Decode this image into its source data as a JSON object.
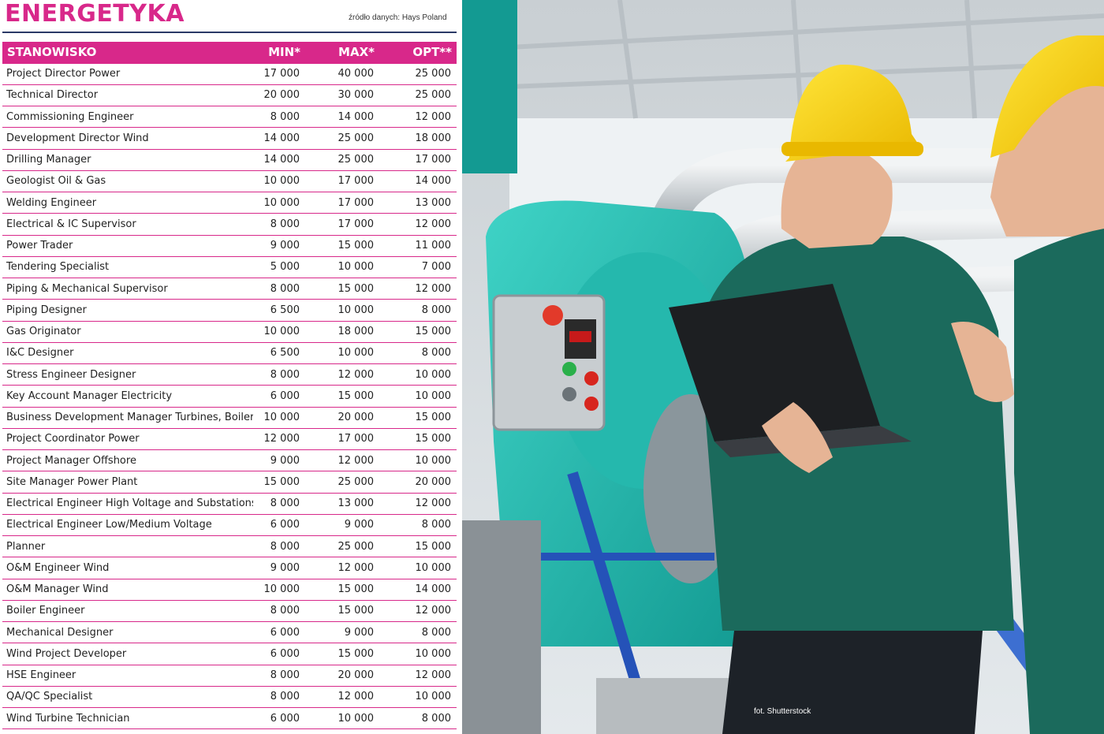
{
  "header": {
    "title": "ENERGETYKA",
    "source": "źródło danych: Hays Poland"
  },
  "table": {
    "columns": [
      "STANOWISKO",
      "MIN*",
      "MAX*",
      "OPT**"
    ],
    "rows": [
      [
        "Project Director Power",
        "17 000",
        "40 000",
        "25 000"
      ],
      [
        "Technical Director",
        "20 000",
        "30 000",
        "25 000"
      ],
      [
        "Commissioning Engineer",
        "8 000",
        "14 000",
        "12 000"
      ],
      [
        "Development Director Wind",
        "14 000",
        "25 000",
        "18 000"
      ],
      [
        "Drilling Manager",
        "14 000",
        "25 000",
        "17 000"
      ],
      [
        "Geologist Oil & Gas",
        "10 000",
        "17 000",
        "14 000"
      ],
      [
        "Welding Engineer",
        "10 000",
        "17 000",
        "13 000"
      ],
      [
        "Electrical & IC Supervisor",
        "8 000",
        "17 000",
        "12 000"
      ],
      [
        "Power Trader",
        "9 000",
        "15 000",
        "11 000"
      ],
      [
        "Tendering Specialist",
        "5 000",
        "10 000",
        "7 000"
      ],
      [
        "Piping & Mechanical Supervisor",
        "8 000",
        "15 000",
        "12 000"
      ],
      [
        "Piping Designer",
        "6 500",
        "10 000",
        "8 000"
      ],
      [
        "Gas Originator",
        "10 000",
        "18 000",
        "15 000"
      ],
      [
        "I&C Designer",
        "6 500",
        "10 000",
        "8 000"
      ],
      [
        "Stress Engineer Designer",
        "8 000",
        "12 000",
        "10 000"
      ],
      [
        "Key Account Manager Electricity",
        "6 000",
        "15 000",
        "10 000"
      ],
      [
        "Business Development Manager Turbines, Boilers",
        "10 000",
        "20 000",
        "15 000"
      ],
      [
        "Project Coordinator Power",
        "12 000",
        "17 000",
        "15 000"
      ],
      [
        "Project Manager Offshore",
        "9 000",
        "12 000",
        "10 000"
      ],
      [
        "Site Manager Power Plant",
        "15 000",
        "25 000",
        "20 000"
      ],
      [
        "Electrical Engineer High Voltage and Substations",
        "8 000",
        "13 000",
        "12 000"
      ],
      [
        "Electrical Engineer Low/Medium Voltage",
        "6 000",
        "9 000",
        "8 000"
      ],
      [
        "Planner",
        "8 000",
        "25 000",
        "15 000"
      ],
      [
        "O&M Engineer Wind",
        "9 000",
        "12 000",
        "10 000"
      ],
      [
        "O&M Manager Wind",
        "10 000",
        "15 000",
        "14 000"
      ],
      [
        "Boiler Engineer",
        "8 000",
        "15 000",
        "12 000"
      ],
      [
        "Mechanical Designer",
        "6 000",
        "9 000",
        "8 000"
      ],
      [
        "Wind Project Developer",
        "6 000",
        "15 000",
        "10 000"
      ],
      [
        "HSE Engineer",
        "8 000",
        "20 000",
        "12 000"
      ],
      [
        "QA/QC Specialist",
        "8 000",
        "12 000",
        "10 000"
      ],
      [
        "Wind Turbine Technician",
        "6 000",
        "10 000",
        "8 000"
      ]
    ]
  },
  "photo": {
    "credit": "fot. Shutterstock"
  },
  "colors": {
    "accent": "#d8288a",
    "rule": "#2b3a67"
  }
}
